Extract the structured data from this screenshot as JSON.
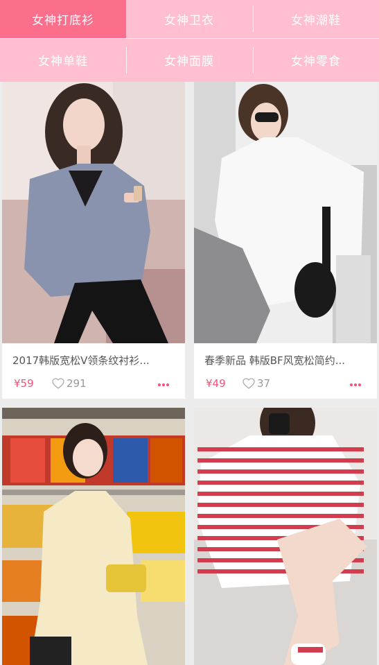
{
  "categories": {
    "row1": [
      {
        "label": "女神打底衫",
        "active": true
      },
      {
        "label": "女神卫衣",
        "active": false
      },
      {
        "label": "女神潮鞋",
        "active": false
      }
    ],
    "row2": [
      {
        "label": "女神单鞋",
        "active": false
      },
      {
        "label": "女神面膜",
        "active": false
      },
      {
        "label": "女神零食",
        "active": false
      }
    ]
  },
  "products": [
    {
      "title": "2017韩版宽松V领条纹衬衫...",
      "price": "¥59",
      "likes": "291"
    },
    {
      "title": "春季新品 韩版BF风宽松简约...",
      "price": "¥49",
      "likes": "37"
    },
    {
      "title": "",
      "price": "",
      "likes": ""
    },
    {
      "title": "",
      "price": "",
      "likes": ""
    }
  ],
  "colors": {
    "tab_bar_bg": "#ffbfd0",
    "tab_active_bg": "#fb6f8c",
    "price_color": "#fb4e77",
    "page_bg": "#ececec"
  },
  "icons": {
    "like": "heart-outline-icon",
    "more": "three-dots-icon"
  }
}
